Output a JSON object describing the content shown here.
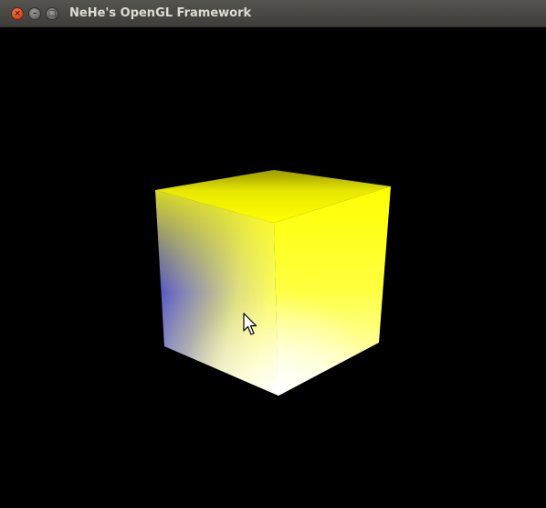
{
  "window": {
    "title": "NeHe's OpenGL Framework",
    "controls": {
      "close_icon": "close-icon",
      "minimize_icon": "minimize-icon",
      "maximize_icon": "maximize-icon"
    }
  },
  "viewport": {
    "background": "#000000",
    "scene": "rotating-color-cube",
    "cube_colors": {
      "top": "#ffff00",
      "left_face_edge": "#0000ff",
      "front_corner": "#ffffff",
      "right_face": "#ffff00"
    }
  },
  "cursor": {
    "icon": "arrow-cursor-icon"
  }
}
